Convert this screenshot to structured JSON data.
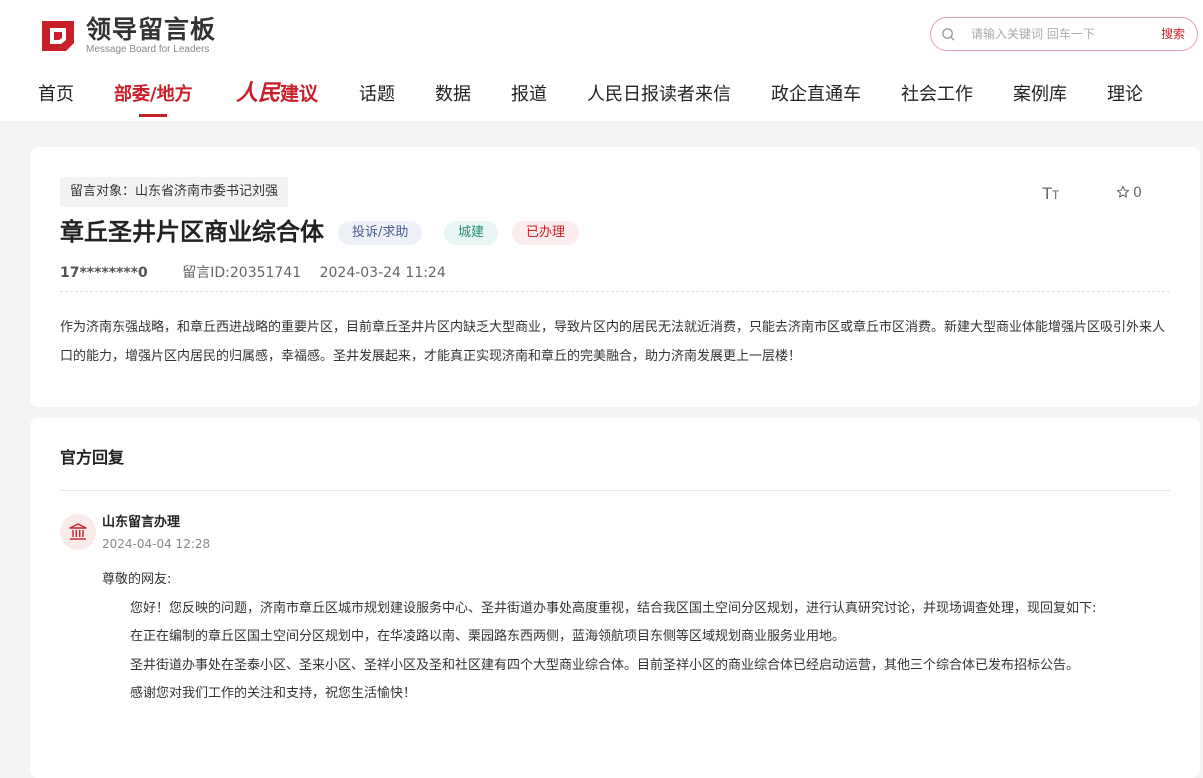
{
  "header": {
    "logo_title": "领导留言板",
    "logo_subtitle": "Message Board for Leaders",
    "search_placeholder": "请输入关键词 回车一下",
    "search_button": "搜索"
  },
  "nav": {
    "home": "首页",
    "ministries": "部委/地方",
    "brand_part1": "人民",
    "brand_part2": "建议",
    "topics": "话题",
    "data": "数据",
    "reports": "报道",
    "readers_letters": "人民日报读者来信",
    "gov_business": "政企直通车",
    "social_work": "社会工作",
    "cases": "案例库",
    "theory": "理论",
    "active_item": "部委/地方"
  },
  "message": {
    "target": "留言对象：山东省济南市委书记刘强",
    "title": "章丘圣井片区商业综合体",
    "type_badge": "投诉/求助",
    "category_badge": "城建",
    "status_badge": "已办理",
    "user": "17********0",
    "message_id": "留言ID:20351741",
    "datetime": "2024-03-24 11:24",
    "favorite_count": "0",
    "content": "作为济南东强战略，和章丘西进战略的重要片区，目前章丘圣井片区内缺乏大型商业，导致片区内的居民无法就近消费，只能去济南市区或章丘市区消费。新建大型商业体能增强片区吸引外来人口的能力，增强片区内居民的归属感，幸福感。圣井发展起来，才能真正实现济南和章丘的完美融合，助力济南发展更上一层楼！"
  },
  "reply": {
    "section_title": "官方回复",
    "replier": "山东留言办理",
    "date": "2024-04-04 12:28",
    "greeting": "尊敬的网友:",
    "p1": "您好！您反映的问题，济南市章丘区城市规划建设服务中心、圣井街道办事处高度重视，结合我区国土空间分区规划，进行认真研究讨论，并现场调查处理，现回复如下:",
    "p2": "在正在编制的章丘区国土空间分区规划中，在华凌路以南、栗园路东西两侧，蓝海领航项目东侧等区域规划商业服务业用地。",
    "p3": "圣井街道办事处在圣泰小区、圣来小区、圣祥小区及圣和社区建有四个大型商业综合体。目前圣祥小区的商业综合体已经启动运营，其他三个综合体已发布招标公告。",
    "p4": "感谢您对我们工作的关注和支持，祝您生活愉快！"
  },
  "colors": {
    "brand_red": "#c8202a",
    "page_bg": "#f3f4f6"
  }
}
